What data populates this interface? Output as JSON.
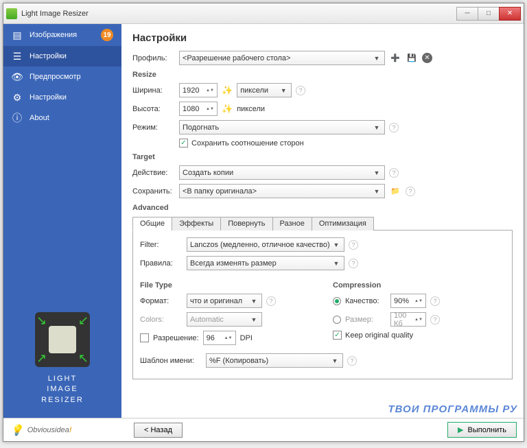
{
  "window": {
    "title": "Light Image Resizer"
  },
  "sidebar": {
    "items": [
      {
        "label": "Изображения",
        "badge": "19"
      },
      {
        "label": "Настройки"
      },
      {
        "label": "Предпросмотр"
      },
      {
        "label": "Настройки"
      },
      {
        "label": "About"
      }
    ],
    "logo_lines": [
      "LIGHT",
      "IMAGE",
      "RESIZER"
    ]
  },
  "page": {
    "title": "Настройки",
    "profile": {
      "label": "Профиль:",
      "value": "<Разрешение рабочего стола>"
    },
    "resize": {
      "heading": "Resize",
      "width_label": "Ширина:",
      "width_value": "1920",
      "width_unit": "пиксели",
      "height_label": "Высота:",
      "height_value": "1080",
      "height_unit": "пиксели",
      "mode_label": "Режим:",
      "mode_value": "Подогнать",
      "keep_ratio": "Сохранить соотношение сторон"
    },
    "target": {
      "heading": "Target",
      "action_label": "Действие:",
      "action_value": "Создать копии",
      "save_label": "Сохранить:",
      "save_value": "<В папку оригинала>"
    },
    "advanced": {
      "heading": "Advanced",
      "tabs": [
        "Общие",
        "Эффекты",
        "Повернуть",
        "Разное",
        "Оптимизация"
      ],
      "filter_label": "Filter:",
      "filter_value": "Lanczos  (медленно, отличное качество)",
      "rules_label": "Правила:",
      "rules_value": "Всегда изменять размер",
      "filetype_heading": "File Type",
      "format_label": "Формат:",
      "format_value": "что и оригинал",
      "colors_label": "Colors:",
      "colors_value": "Automatic",
      "res_label": "Разрешение:",
      "res_value": "96",
      "res_unit": "DPI",
      "template_label": "Шаблон имени:",
      "template_value": "%F (Копировать)",
      "compression_heading": "Compression",
      "quality_label": "Качество:",
      "quality_value": "90%",
      "size_label": "Размер:",
      "size_value": "100 Кб",
      "keep_quality": "Keep original quality"
    },
    "footer": {
      "brand": "Obviousidea",
      "brand_excl": "!",
      "back": "< Назад",
      "run": "Выполнить"
    }
  },
  "watermark": "ТВОИ ПРОГРАММЫ РУ"
}
